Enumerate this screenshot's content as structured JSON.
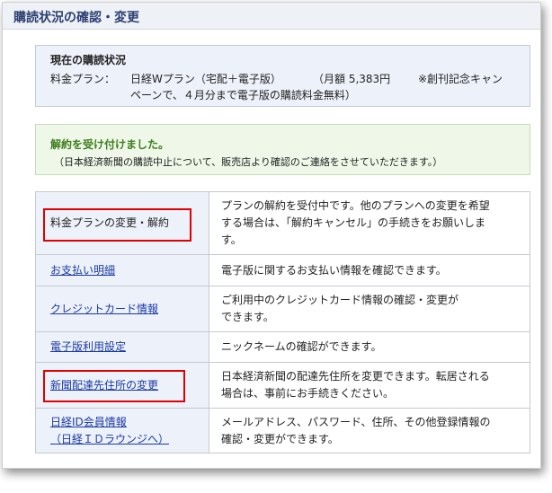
{
  "header": {
    "title": "購読状況の確認・変更"
  },
  "current": {
    "title": "現在の購読状況",
    "plan_label": "料金プラン：",
    "plan_name": "日経Wプラン（宅配＋電子版）",
    "plan_price": "（月額 5,383円",
    "plan_note_line1": "※創刊記念キャン",
    "plan_note_line2": "ペーンで、４月分まで電子版の購読料金無料）"
  },
  "notice": {
    "title": "解約を受け付けました。",
    "description": "（日本経済新聞の購読中止について、販売店より確認のご連絡をさせていただきます。）"
  },
  "menu": {
    "rows": [
      {
        "link_lines": [
          "料金プランの変更・解約"
        ],
        "linked": false,
        "desc_lines": [
          "プランの解約を受付中です。他のプランへの変更を希望",
          "する場合は、「解約キャンセル」の手続きをお願いしま",
          "す。"
        ]
      },
      {
        "link_lines": [
          "お支払い明細"
        ],
        "linked": true,
        "desc_lines": [
          "電子版に関するお支払い情報を確認できます。"
        ]
      },
      {
        "link_lines": [
          "クレジットカード情報"
        ],
        "linked": true,
        "desc_lines": [
          "ご利用中のクレジットカード情報の確認・変更が",
          "できます。"
        ]
      },
      {
        "link_lines": [
          "電子版利用設定"
        ],
        "linked": true,
        "desc_lines": [
          "ニックネームの確認ができます。"
        ]
      },
      {
        "link_lines": [
          "新聞配達先住所の変更"
        ],
        "linked": true,
        "desc_lines": [
          "日本経済新聞の配達先住所を変更できます。転居される",
          "場合は、事前にお手続きください。"
        ]
      },
      {
        "link_lines": [
          "日経ID会員情報",
          "（日経ＩＤラウンジへ）"
        ],
        "linked": true,
        "desc_lines": [
          "メールアドレス、パスワード、住所、その他登録情報の",
          "確認・変更ができます。"
        ]
      }
    ]
  }
}
